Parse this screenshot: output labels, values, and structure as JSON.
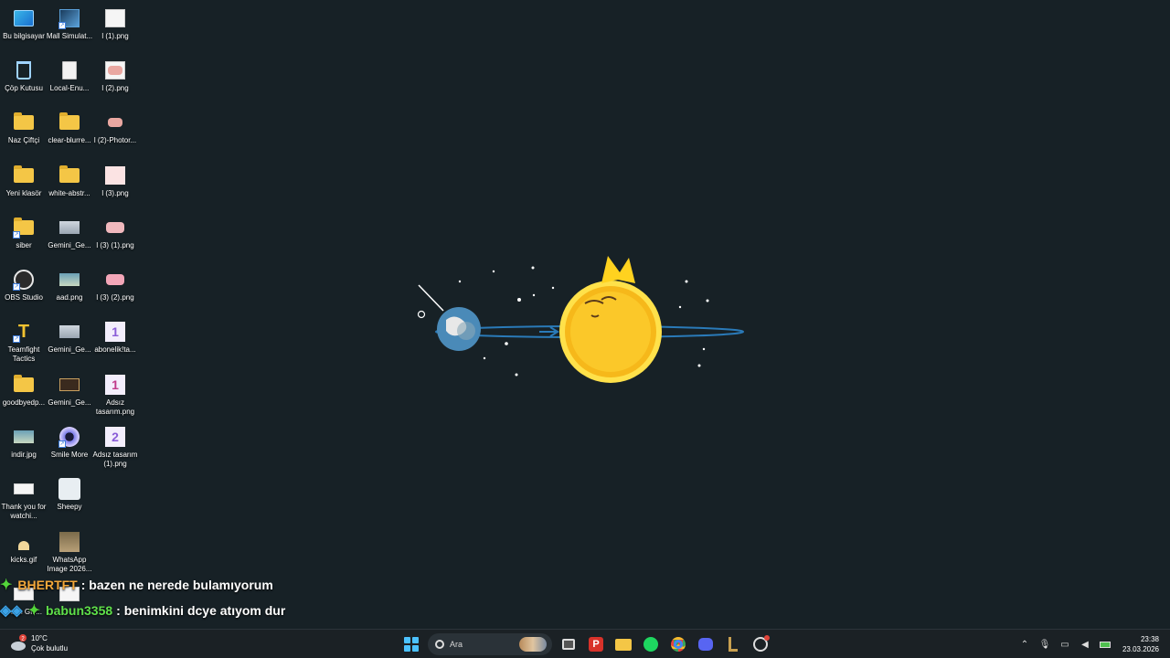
{
  "desktop": {
    "col1": [
      {
        "label": "Bu bilgisayar",
        "icon": "this-pc-icon"
      },
      {
        "label": "Çöp Kutusu",
        "icon": "recycle-bin-icon"
      },
      {
        "label": "Naz Çiftçi",
        "icon": "folder-icon"
      },
      {
        "label": "Yeni klasör",
        "icon": "folder-icon"
      },
      {
        "label": "siber",
        "icon": "folder-icon"
      },
      {
        "label": "OBS Studio",
        "icon": "obs-icon"
      },
      {
        "label": "Teamfight Tactics",
        "icon": "tft-icon"
      },
      {
        "label": "goodbyedp...",
        "icon": "folder-icon"
      },
      {
        "label": "indir.jpg",
        "icon": "image-icon"
      },
      {
        "label": "Thank you for watchi...",
        "icon": "image-icon"
      },
      {
        "label": "kicks.gif",
        "icon": "gif-icon"
      },
      {
        "label": "Pooh GIF...",
        "icon": "gif-icon"
      }
    ],
    "col2": [
      {
        "label": "Mall Simulat...",
        "icon": "game-icon"
      },
      {
        "label": "Local-Enu...",
        "icon": "document-icon"
      },
      {
        "label": "clear-blurre...",
        "icon": "folder-icon"
      },
      {
        "label": "white-abstr...",
        "icon": "folder-icon"
      },
      {
        "label": "Gemini_Ge...",
        "icon": "image-icon"
      },
      {
        "label": "aad.png",
        "icon": "image-icon"
      },
      {
        "label": "Gemini_Ge...",
        "icon": "image-icon"
      },
      {
        "label": "Gemini_Ge...",
        "icon": "image-icon"
      },
      {
        "label": "Smile More",
        "icon": "smile-more-icon"
      },
      {
        "label": "Sheepy",
        "icon": "sheepy-icon"
      },
      {
        "label": "WhatsApp Image 2026...",
        "icon": "image-icon"
      },
      {
        "label": "",
        "icon": "image-icon"
      }
    ],
    "col3": [
      {
        "label": "l (1).png",
        "icon": "image-icon"
      },
      {
        "label": "l (2).png",
        "icon": "image-icon"
      },
      {
        "label": "l (2)-Photor...",
        "icon": "image-icon"
      },
      {
        "label": "l (3).png",
        "icon": "image-icon"
      },
      {
        "label": "l (3) (1).png",
        "icon": "image-icon"
      },
      {
        "label": "l (3) (2).png",
        "icon": "image-icon"
      },
      {
        "label": "abonelik!ta...",
        "icon": "image-icon"
      },
      {
        "label": "Adsız tasarım.png",
        "icon": "image-icon"
      },
      {
        "label": "Adsız tasarım (1).png",
        "icon": "image-icon"
      }
    ]
  },
  "chat": [
    {
      "user": "BHERTFT",
      "message": ": bazen ne nerede bulamıyorum"
    },
    {
      "user": "babun3358",
      "message": ": benimkini dcye atıyom dur"
    }
  ],
  "taskbar": {
    "weather_temp": "10°C",
    "weather_desc": "Çok bulutlu",
    "weather_badge": "2",
    "search_placeholder": "Ara",
    "pinned": [
      "start-icon",
      "search-icon",
      "task-view-icon",
      "proton-vpn-icon",
      "file-explorer-icon",
      "spotify-icon",
      "chrome-icon",
      "discord-icon",
      "league-icon",
      "app-icon"
    ],
    "time": "23:38",
    "date": "23.03.2026"
  },
  "colors": {
    "background": "#172126",
    "taskbar": "#1b2125",
    "chat_badge": "#53d53a",
    "user1": "#f4a83a",
    "user2": "#5fe04a"
  }
}
